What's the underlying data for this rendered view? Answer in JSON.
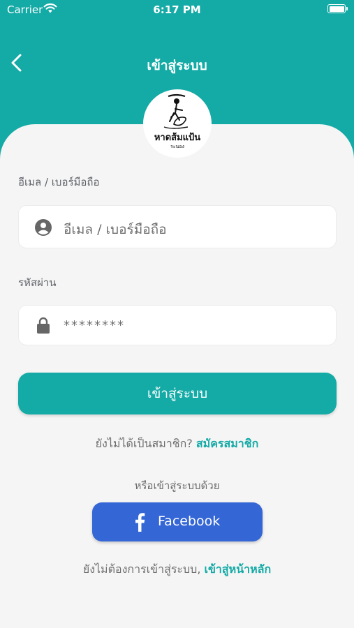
{
  "status_bar": {
    "carrier": "Carrier",
    "time": "6:17 PM"
  },
  "nav": {
    "title": "เข้าสู่ระบบ"
  },
  "logo": {
    "name": "หาดส้มแป้น",
    "subtitle": "ระนอง"
  },
  "form": {
    "email_label": "อีเมล / เบอร์มือถือ",
    "email_placeholder": "อีเมล / เบอร์มือถือ",
    "password_label": "รหัสผ่าน",
    "password_value": "********"
  },
  "login_button": "เข้าสู่ระบบ",
  "register": {
    "prompt": "ยังไม่ได้เป็นสมาชิก? ",
    "link": "สมัครสมาชิก"
  },
  "social": {
    "prompt": "หรือเข้าสู่ระบบด้วย",
    "facebook_label": "Facebook"
  },
  "skip": {
    "prompt": "ยังไม่ต้องการเข้าสู่ระบบ, ",
    "link": "เข้าสู่หน้าหลัก"
  },
  "colors": {
    "primary": "#14aaa6",
    "facebook": "#3466d6",
    "background": "#f5f5f5"
  },
  "icons": {
    "back": "chevron-left-icon",
    "email": "user-circle-icon",
    "password": "lock-icon",
    "facebook": "facebook-f-icon"
  }
}
